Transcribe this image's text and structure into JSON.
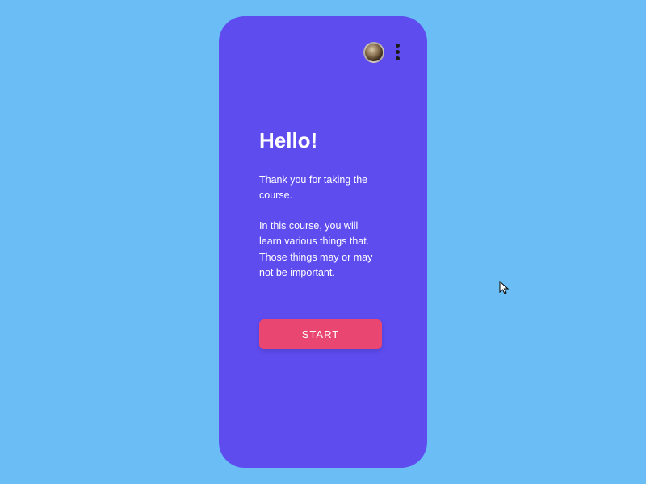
{
  "header": {
    "avatar_alt": "user-avatar",
    "menu_alt": "more-options"
  },
  "content": {
    "title": "Hello!",
    "paragraph1": "Thank you for taking the course.",
    "paragraph2": "In this course, you will learn various things that. Those things may or may not be important."
  },
  "actions": {
    "start_label": "START"
  },
  "colors": {
    "background": "#6bbef5",
    "card": "#5e4cef",
    "button": "#e94771",
    "text": "#ffffff"
  }
}
